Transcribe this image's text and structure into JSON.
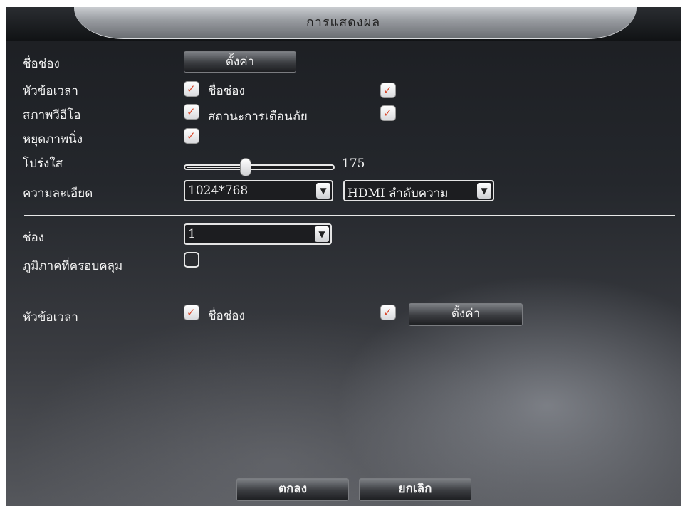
{
  "window": {
    "title": "การแสดงผล"
  },
  "rows": {
    "channel_name": {
      "label": "ชื่อช่อง",
      "button": "ตั้งค่า"
    },
    "time_title": {
      "label": "หัวข้อเวลา",
      "checked": true,
      "option2_label": "ชื่อช่อง",
      "option2_checked": true
    },
    "video_status": {
      "label": "สภาพวีอีโอ",
      "checked": true,
      "option2_label": "สถานะการเตือนภัย",
      "option2_checked": true
    },
    "freeze": {
      "label": "หยุดภาพนิ่ง",
      "checked": true
    },
    "transparency": {
      "label": "โปร่งใส",
      "value": "175",
      "level_fraction": 0.42
    },
    "resolution": {
      "label": "ความละเอียด",
      "value": "1024*768",
      "output_value": "HDMI ลำดับความ"
    }
  },
  "channel_section": {
    "channel": {
      "label": "ช่อง",
      "value": "1"
    },
    "cover_area": {
      "label": "ภูมิภาคที่ครอบคลุม",
      "checked": false
    },
    "time_title2": {
      "label": "หัวข้อเวลา",
      "checked": true,
      "option2_label": "ชื่อช่อง",
      "option2_checked": true,
      "button": "ตั้งค่า"
    }
  },
  "footer": {
    "ok_label": "ตกลง",
    "cancel_label": "ยกเลิก"
  },
  "colors": {
    "tick": "#d9472b",
    "background": "#24272c",
    "title_bar": "#9a9da2"
  },
  "icons": {
    "checkbox_check": "check-icon",
    "dropdown": "chevron-down-icon"
  }
}
